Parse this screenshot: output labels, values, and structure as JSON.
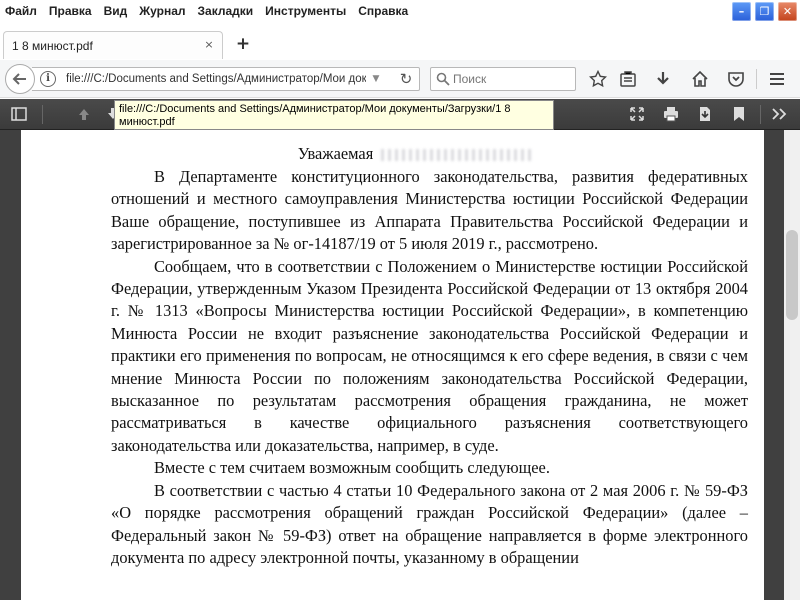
{
  "menubar": {
    "items": [
      "Файл",
      "Правка",
      "Вид",
      "Журнал",
      "Закладки",
      "Инструменты",
      "Справка"
    ]
  },
  "window_controls": {
    "minimize": "–",
    "maximize": "❐",
    "close": "✕"
  },
  "tab": {
    "title": "1 8 минюст.pdf",
    "close": "×",
    "new_tab": "+"
  },
  "navbar": {
    "url": "file:///C:/Documents and Settings/Администратор/Мои доку",
    "search_placeholder": "Поиск"
  },
  "tooltip": {
    "text": "file:///C:/Documents and Settings/Администратор/Мои документы/Загрузки/1 8 минюст.pdf"
  },
  "document": {
    "salutation": "Уважаемая",
    "paragraphs": [
      "В Департаменте конституционного законодательства, развития федеративных отношений и местного самоуправления Министерства юстиции Российской Федерации Ваше обращение, поступившее из Аппарата Правительства Российской Федерации и зарегистрированное за № ог-14187/19 от 5 июля 2019 г., рассмотрено.",
      "Сообщаем, что в соответствии с Положением о Министерстве юстиции Российской Федерации, утвержденным Указом Президента Российской Федерации от 13 октября 2004 г. № 1313 «Вопросы Министерства юстиции Российской Федерации», в компетенцию Минюста России не входит разъяснение законодательства Российской Федерации и практики его применения по вопросам, не относящимся к его сфере ведения, в связи с чем мнение Минюста России по положениям законодательства Российской Федерации, высказанное по результатам рассмотрения обращения гражданина, не может рассматриваться в качестве официального разъяснения соответствующего законодательства или доказательства, например, в суде.",
      "Вместе с тем считаем возможным сообщить следующее.",
      "В соответствии с частью 4 статьи 10 Федерального закона от 2 мая 2006 г. № 59-ФЗ «О порядке рассмотрения обращений граждан Российской Федерации» (далее – Федеральный закон № 59-ФЗ) ответ на обращение направляется в форме электронного документа по адресу электронной почты, указанному в обращении"
    ]
  }
}
